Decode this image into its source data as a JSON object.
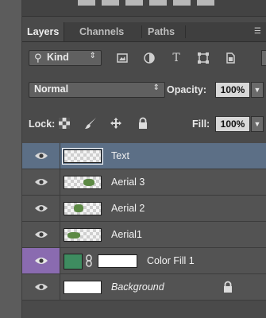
{
  "tabs": [
    {
      "label": "Layers"
    },
    {
      "label": "Channels"
    },
    {
      "label": "Paths"
    }
  ],
  "filter": {
    "kind_label": "Kind"
  },
  "blend_mode": "Normal",
  "opacity": {
    "label": "Opacity:",
    "value": "100%"
  },
  "lock": {
    "label": "Lock:"
  },
  "fill": {
    "label": "Fill:",
    "value": "100%"
  },
  "layers": [
    {
      "name": "Text"
    },
    {
      "name": "Aerial 3"
    },
    {
      "name": "Aerial 2"
    },
    {
      "name": "Aerial1"
    },
    {
      "name": "Color Fill 1"
    },
    {
      "name": "Background"
    }
  ],
  "colors": {
    "selected_row": "#5c6f86",
    "eye_highlight": "#8a6bb0",
    "color_fill_swatch": "#3e8c60"
  }
}
